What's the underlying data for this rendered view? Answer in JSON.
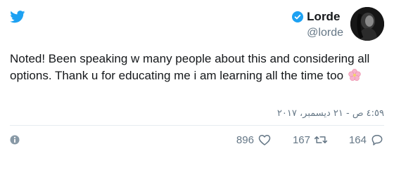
{
  "user": {
    "display_name": "Lorde",
    "handle": "@lorde"
  },
  "tweet": {
    "text": "Noted! Been speaking w many people about this and considering all options. Thank u for educating me i am learning all the time too",
    "timestamp": "٤:٥٩ ص - ٢١ ديسمبر، ٢٠١٧"
  },
  "actions": {
    "likes": "896",
    "retweets": "167",
    "replies": "164"
  },
  "icons": {
    "brand": "twitter-bird-icon",
    "verified": "verified-badge-icon",
    "emoji": "cherry-blossom-icon",
    "info": "info-icon",
    "like": "heart-icon",
    "retweet": "retweet-icon",
    "reply": "reply-icon"
  },
  "colors": {
    "twitter_blue": "#1da1f2",
    "text": "#14171a",
    "muted": "#657786",
    "divider": "#e6ecf0",
    "blossom": "#f5a7c4"
  }
}
